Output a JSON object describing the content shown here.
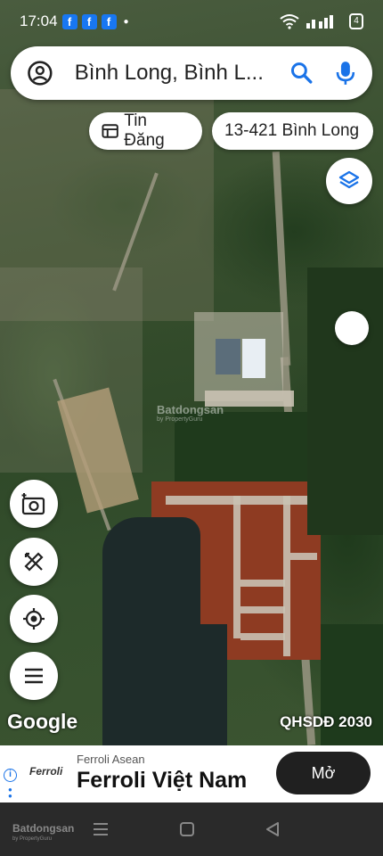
{
  "status_bar": {
    "time": "17:04",
    "notif_fb": "f",
    "battery": "4"
  },
  "search": {
    "value": "Bình Long, Bình L..."
  },
  "chips": [
    {
      "label": "Tin Đăng"
    },
    {
      "label": "13-421 Bình Long"
    }
  ],
  "map": {
    "attribution": "Google",
    "layer_label": "QHSDĐ 2030",
    "watermark": "Batdongsan",
    "watermark_sub": "by PropertyGuru"
  },
  "ad": {
    "advertiser": "Ferroli Asean",
    "headline": "Ferroli Việt Nam",
    "logo_text": "Ferroli",
    "cta": "Mở"
  },
  "nav": {
    "brand": "Batdongsan",
    "brand_sub": "by PropertyGuru"
  },
  "colors": {
    "accent": "#1a73e8",
    "ad_button": "#202020"
  }
}
